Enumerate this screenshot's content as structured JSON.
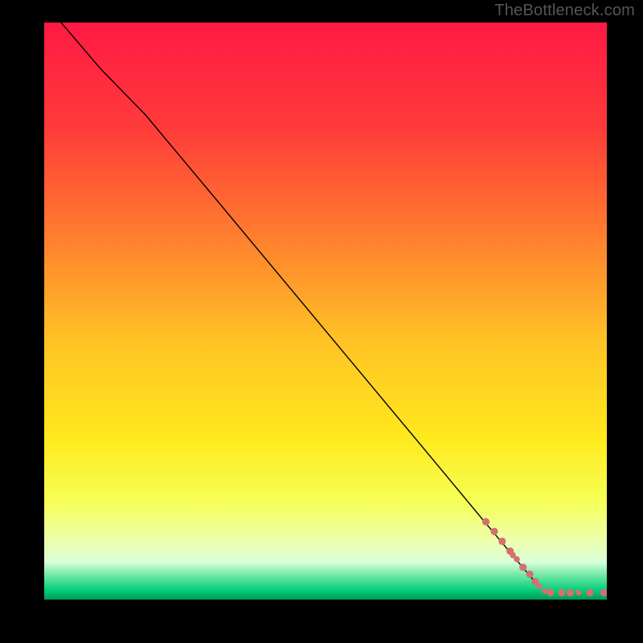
{
  "watermark": "TheBottleneck.com",
  "chart_data": {
    "type": "line",
    "title": "",
    "xlabel": "",
    "ylabel": "",
    "xlim": [
      0,
      100
    ],
    "ylim": [
      0,
      100
    ],
    "grid": false,
    "legend": false,
    "gradient_stops": [
      {
        "offset": 0.0,
        "color": "#ff1a44"
      },
      {
        "offset": 0.18,
        "color": "#ff3a3a"
      },
      {
        "offset": 0.36,
        "color": "#ff7a2f"
      },
      {
        "offset": 0.55,
        "color": "#ffc225"
      },
      {
        "offset": 0.72,
        "color": "#ffe91d"
      },
      {
        "offset": 0.83,
        "color": "#f6ff56"
      },
      {
        "offset": 0.9,
        "color": "#ecffb0"
      },
      {
        "offset": 0.935,
        "color": "#d9ffd9"
      },
      {
        "offset": 0.96,
        "color": "#66e6a0"
      },
      {
        "offset": 0.985,
        "color": "#00cc7a"
      },
      {
        "offset": 1.0,
        "color": "#009955"
      }
    ],
    "series": [
      {
        "name": "bottleneck-curve",
        "stroke": "#000000",
        "stroke_width": 1.4,
        "x": [
          3,
          10,
          18,
          24,
          30,
          40,
          50,
          60,
          70,
          78,
          84,
          88
        ],
        "values": [
          100,
          92,
          84,
          77,
          70,
          58.3,
          46.6,
          34.9,
          23.2,
          13.8,
          6.8,
          2.2
        ]
      }
    ],
    "scatter": {
      "name": "data-points",
      "fill": "#d6706f",
      "points": [
        {
          "x": 78.5,
          "y": 13.5,
          "r": 4.6
        },
        {
          "x": 80.0,
          "y": 11.8,
          "r": 4.6
        },
        {
          "x": 81.4,
          "y": 10.1,
          "r": 4.6
        },
        {
          "x": 82.8,
          "y": 8.4,
          "r": 4.6
        },
        {
          "x": 83.3,
          "y": 7.7,
          "r": 3.8
        },
        {
          "x": 84.0,
          "y": 7.0,
          "r": 3.8
        },
        {
          "x": 85.1,
          "y": 5.6,
          "r": 4.6
        },
        {
          "x": 86.3,
          "y": 4.4,
          "r": 4.6
        },
        {
          "x": 87.3,
          "y": 3.1,
          "r": 4.6
        },
        {
          "x": 88.0,
          "y": 2.3,
          "r": 3.6
        },
        {
          "x": 89.0,
          "y": 1.5,
          "r": 3.6
        },
        {
          "x": 90.0,
          "y": 1.2,
          "r": 4.6
        },
        {
          "x": 92.0,
          "y": 1.2,
          "r": 4.6
        },
        {
          "x": 93.5,
          "y": 1.2,
          "r": 4.6
        },
        {
          "x": 95.0,
          "y": 1.2,
          "r": 3.6
        },
        {
          "x": 97.0,
          "y": 1.2,
          "r": 4.6
        },
        {
          "x": 99.5,
          "y": 1.2,
          "r": 4.6
        }
      ]
    }
  }
}
